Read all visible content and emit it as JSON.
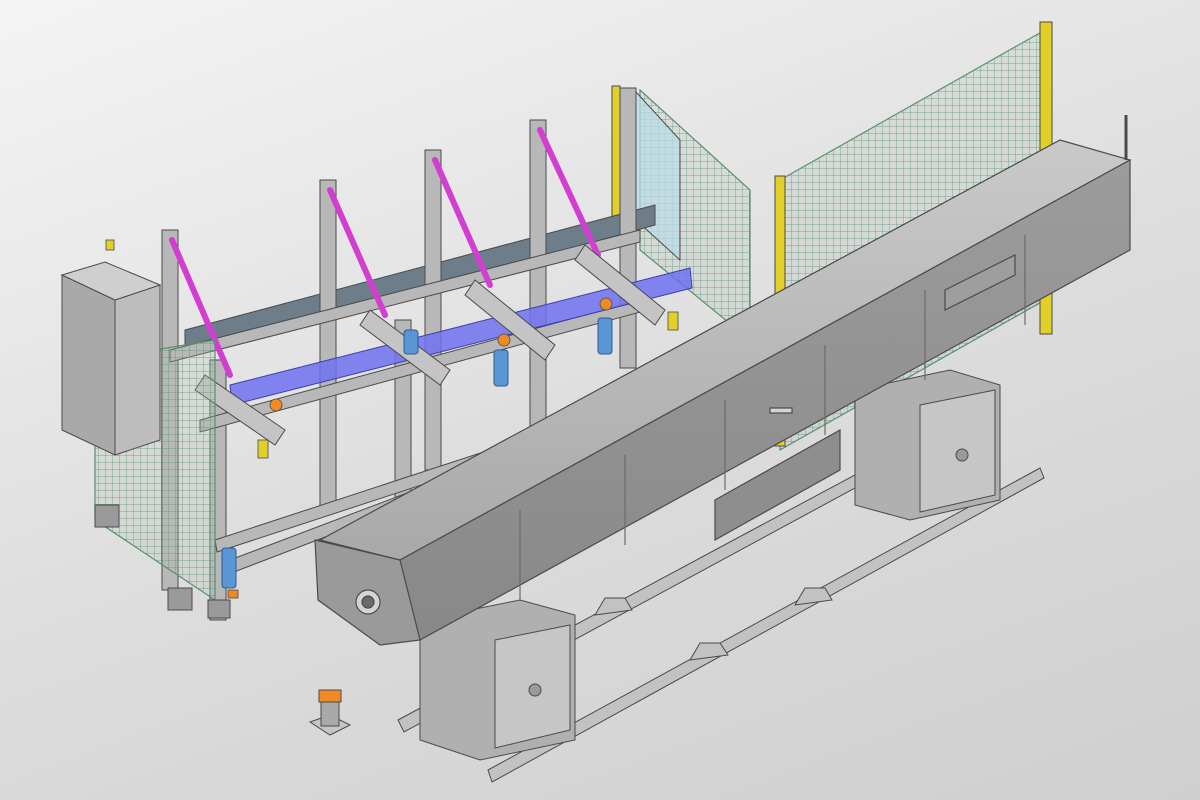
{
  "colors": {
    "background_top": "#f4f4f4",
    "background_bottom": "#cfcfcf",
    "steel": "#b8b8b8",
    "steel_dark": "#8e8e8e",
    "steel_light": "#d4d4d4",
    "outline": "#4a4a4a",
    "strap_magenta": "#d23fd0",
    "shaft_blue": "#6f72f0",
    "motor_blue": "#5a95d6",
    "safety_yellow": "#e2cf2a",
    "marker_orange": "#f08a22",
    "mesh_green": "#5a8f6e",
    "glass": "#b9dbe8"
  },
  "components": [
    "control-cabinet",
    "loading-rack-frame",
    "magenta-lift-straps",
    "blue-drive-shaft",
    "drive-motors",
    "safety-mesh-fence",
    "transparent-guard-panel",
    "bar-feeder-housing",
    "feeder-base-pedestals",
    "floor-rails",
    "sensor-post"
  ]
}
